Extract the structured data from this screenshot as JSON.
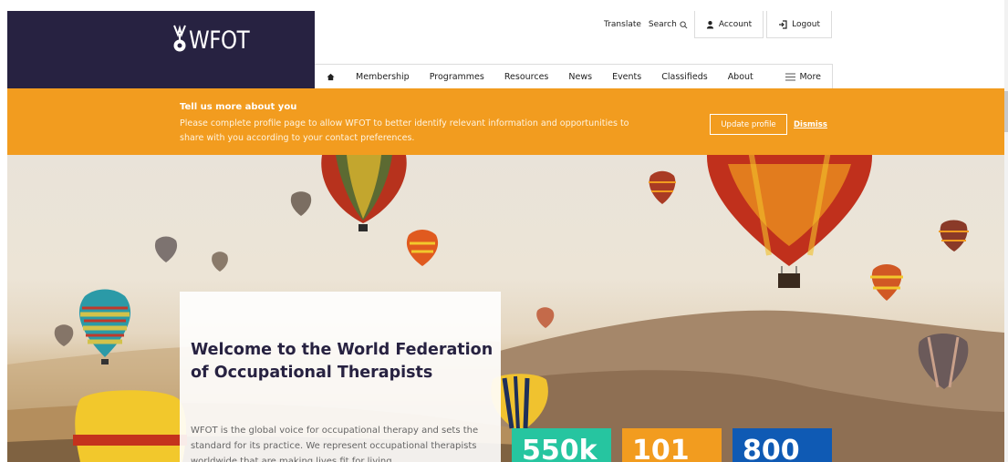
{
  "header": {
    "logo_text": "WFOT",
    "utility": {
      "translate": "Translate",
      "search": "Search",
      "account": "Account",
      "logout": "Logout"
    },
    "nav": {
      "items": [
        "Membership",
        "Programmes",
        "Resources",
        "News",
        "Events",
        "Classifieds",
        "About"
      ],
      "more": "More"
    }
  },
  "banner": {
    "title": "Tell us more about you",
    "message": "Please complete profile page to allow WFOT to better identify relevant information and opportunities to share with you according to your contact preferences.",
    "update_button": "Update profile",
    "dismiss_link": "Dismiss"
  },
  "hero": {
    "title": "Welcome to the World Federation of Occupational Therapists",
    "text": "WFOT is the global voice for occupational therapy and sets the standard for its practice. We represent occupational therapists worldwide that are making lives fit for living."
  },
  "stats": [
    "550k",
    "101",
    "800"
  ],
  "colors": {
    "navy": "#272241",
    "orange": "#f29c1f",
    "teal": "#26c5a0",
    "blue": "#0f5ab4"
  },
  "icons": {
    "home": "home-icon",
    "search": "search-icon",
    "account": "user-icon",
    "logout": "logout-icon",
    "more": "hamburger-icon"
  }
}
